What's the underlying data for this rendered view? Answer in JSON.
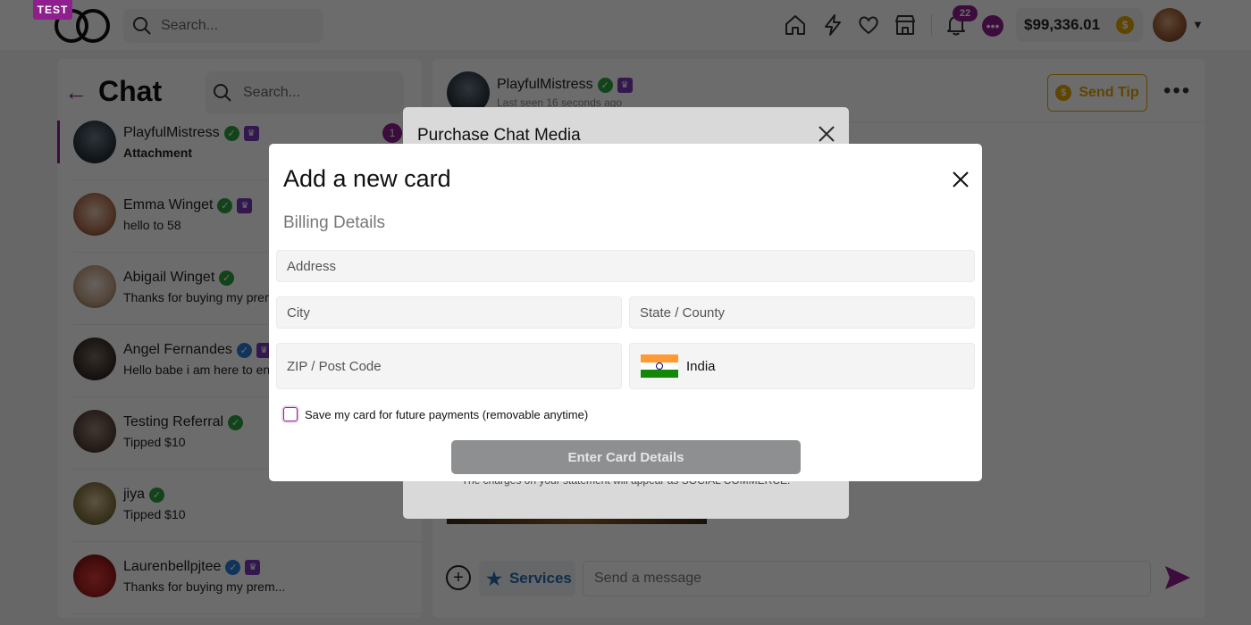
{
  "app": {
    "badge": "TEST",
    "search_placeholder": "Search...",
    "notification_count": "22",
    "balance": "$99,336.01"
  },
  "chat": {
    "title": "Chat",
    "search_placeholder": "Search...",
    "items": [
      {
        "name": "PlayfulMistress",
        "message": "Attachment",
        "verified": "green",
        "crown": true,
        "unread": "1",
        "active": true,
        "bold": true
      },
      {
        "name": "Emma Winget",
        "message": "hello to 58",
        "verified": "green",
        "crown": true
      },
      {
        "name": "Abigail Winget",
        "message": "Thanks for buying my prem...",
        "verified": "green",
        "crown": false
      },
      {
        "name": "Angel Fernandes",
        "message": "Hello babe i am here to ent...",
        "verified": "blue",
        "crown": true
      },
      {
        "name": "Testing Referral",
        "message": "Tipped $10",
        "verified": "green",
        "crown": false
      },
      {
        "name": "jiya",
        "message": "Tipped $10",
        "verified": "green",
        "crown": false
      },
      {
        "name": "Laurenbellpjtee",
        "message": "Thanks for buying my prem...",
        "verified": "blue",
        "crown": true
      }
    ]
  },
  "conversation": {
    "name": "PlayfulMistress",
    "status": "Last seen 16 seconds ago",
    "send_tip_label": "Send Tip",
    "services_label": "Services",
    "message_placeholder": "Send a message"
  },
  "purchase_modal": {
    "title": "Purchase Chat Media",
    "note": "The charges on your statement will appear as SOCIAL COMMERCE."
  },
  "card_modal": {
    "title": "Add a new card",
    "section_label": "Billing Details",
    "address_placeholder": "Address",
    "city_placeholder": "City",
    "state_placeholder": "State / County",
    "zip_placeholder": "ZIP / Post Code",
    "country": "India",
    "save_label": "Save my card for future payments (removable anytime)",
    "submit_label": "Enter Card Details"
  },
  "colors": {
    "brand": "#8e1f8e",
    "gold": "#e1a400",
    "verified_green": "#2e9e3e",
    "verified_blue": "#2b7fd4",
    "crown": "#7a3bbd"
  }
}
